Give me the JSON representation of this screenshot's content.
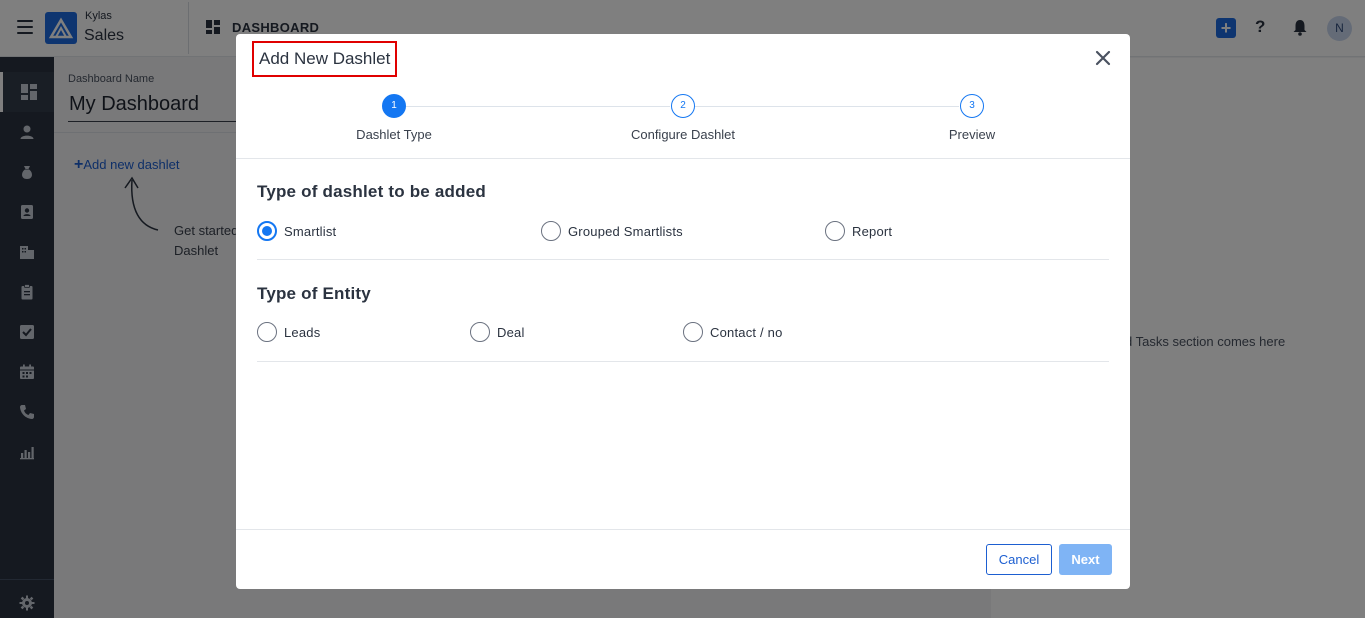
{
  "header": {
    "brand_top": "Kylas",
    "brand_main": "Sales",
    "section_title": "DASHBOARD",
    "avatar_initial": "N",
    "accent": "#1d6ae0"
  },
  "sidebar": {
    "items": [
      {
        "icon": "dashboard-icon"
      },
      {
        "icon": "user-icon"
      },
      {
        "icon": "money-bag-icon"
      },
      {
        "icon": "contact-card-icon"
      },
      {
        "icon": "building-icon"
      },
      {
        "icon": "clipboard-icon"
      },
      {
        "icon": "checkbox-icon"
      },
      {
        "icon": "calendar-icon"
      },
      {
        "icon": "phone-icon"
      },
      {
        "icon": "report-chart-icon"
      },
      {
        "icon": "gear-icon"
      }
    ]
  },
  "background": {
    "dashboard_name_label": "Dashboard Name",
    "dashboard_name": "My Dashboard",
    "add_dashlet": "Add new dashlet",
    "get_started": "Get started",
    "get_started_2": "Dashlet",
    "tasks_text": "d Tasks section comes here"
  },
  "modal": {
    "title": "Add New Dashlet",
    "steps": [
      {
        "number": "1",
        "label": "Dashlet Type"
      },
      {
        "number": "2",
        "label": "Configure Dashlet"
      },
      {
        "number": "3",
        "label": "Preview"
      }
    ],
    "dashlet_type_title": "Type of dashlet to be added",
    "dashlet_types": [
      {
        "label": "Smartlist",
        "checked": true
      },
      {
        "label": "Grouped Smartlists",
        "checked": false
      },
      {
        "label": "Report",
        "checked": false
      }
    ],
    "entity_title": "Type of Entity",
    "entities": [
      {
        "label": "Leads",
        "checked": false
      },
      {
        "label": "Deal",
        "checked": false
      },
      {
        "label": "Contact / no",
        "checked": false
      }
    ],
    "cancel_label": "Cancel",
    "next_label": "Next",
    "step_color": "#1477f2"
  }
}
